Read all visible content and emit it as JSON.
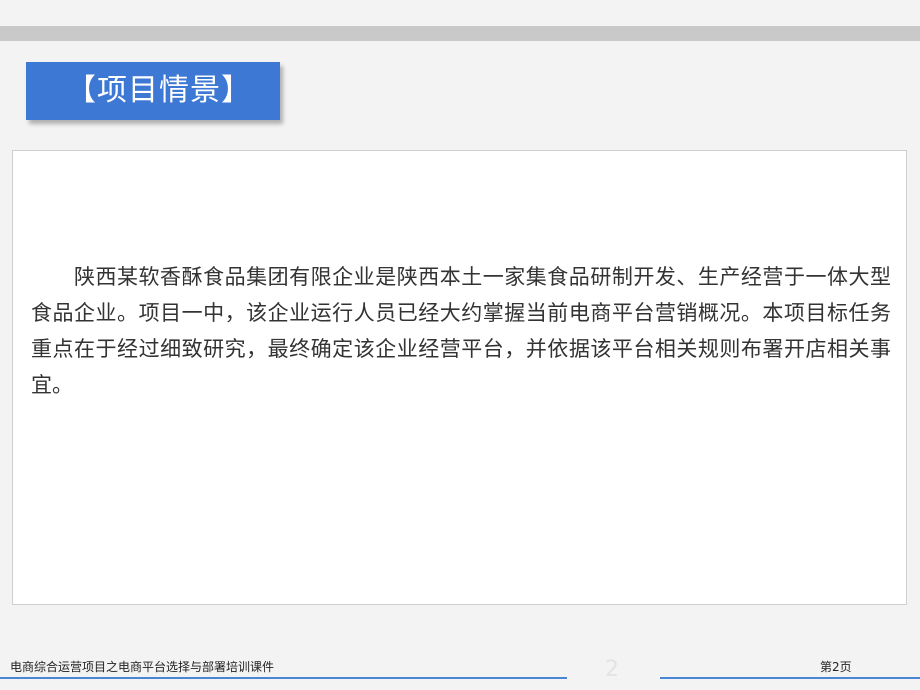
{
  "slide": {
    "title": "【项目情景】",
    "body": "陕西某软香酥食品集团有限企业是陕西本土一家集食品研制开发、生产经营于一体大型食品企业。项目一中，该企业运行人员已经大约掌握当前电商平台营销概况。本项目标任务重点在于经过细致研究，最终确定该企业经营平台，并依据该平台相关规则布署开店相关事宜。"
  },
  "footer": {
    "course_title": "电商综合运营项目之电商平台选择与部署培训课件",
    "page_number": "2",
    "page_label": "第2页"
  },
  "colors": {
    "accent": "#3d78d4",
    "top_band": "#c9c9c9",
    "background": "#f3f3f3"
  }
}
